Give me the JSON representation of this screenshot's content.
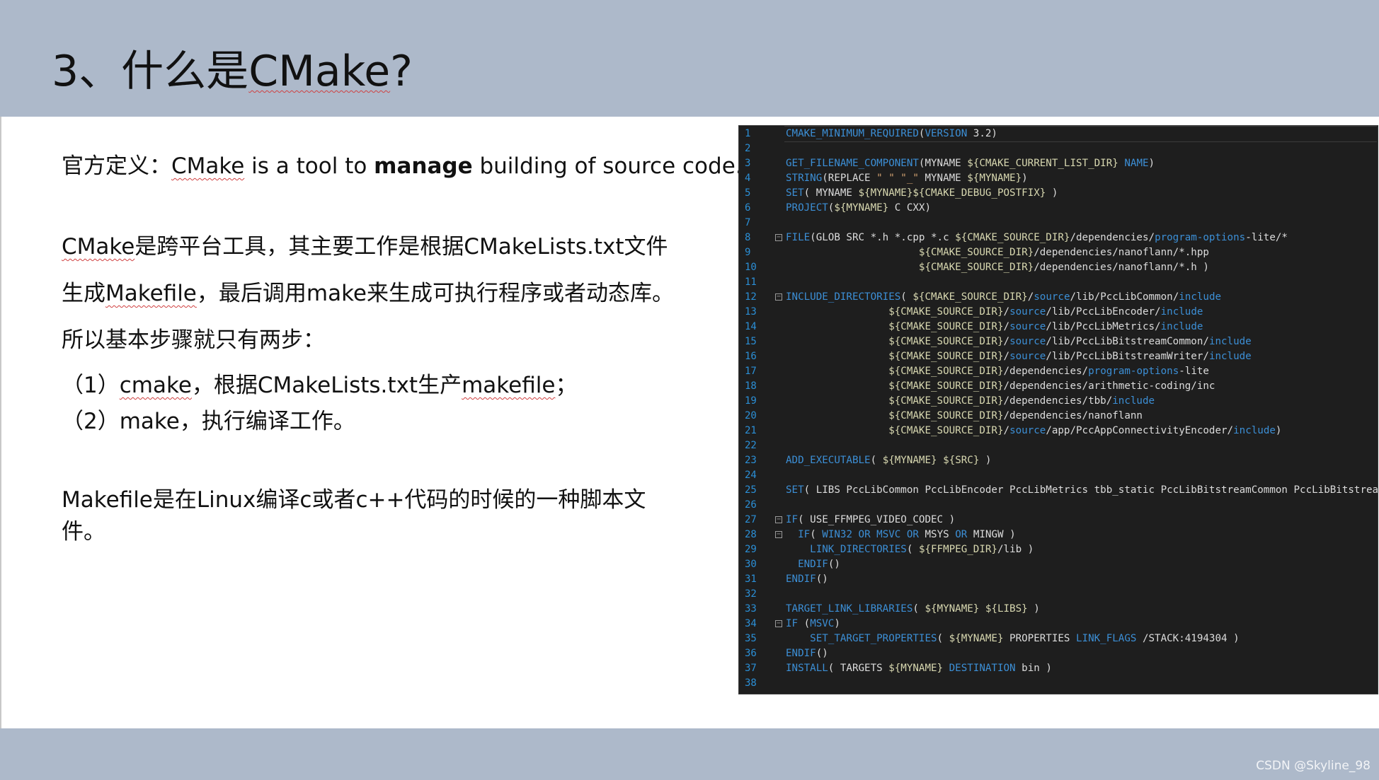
{
  "slide": {
    "title_prefix": "3、什么是",
    "title_word": "CMake",
    "title_suffix": "?",
    "definition": {
      "label": "官方定义：",
      "word": "CMake",
      "text_before_bold": " is a tool to ",
      "bold": "manage",
      "text_after_bold": " building of source code."
    },
    "para1": {
      "word1": "CMake",
      "line1_rest": "是跨平台工具，其主要工作是根据CMakeLists.txt文件",
      "line2_prefix": "生成",
      "line2_word": "Makefile",
      "line2_rest": "，最后调用make来生成可执行程序或者动态库。",
      "line3": "所以基本步骤就只有两步："
    },
    "steps": [
      {
        "prefix": "（1）",
        "word": "cmake",
        "middle": "，根据CMakeLists.txt生产",
        "word2": "makefile",
        "suffix": "；"
      },
      {
        "text": "（2）make，执行编译工作。"
      }
    ],
    "para2": {
      "line1": "Makefile是在Linux编译c或者c++代码的时候的一种脚本文",
      "line2": "件。"
    },
    "watermark": "CSDN @Skyline_98"
  },
  "code": {
    "lines": [
      {
        "n": "1",
        "parts": [
          [
            "kw",
            "CMAKE_MINIMUM_REQUIRED"
          ],
          [
            "plain",
            "("
          ],
          [
            "kw",
            "VERSION"
          ],
          [
            "plain",
            " 3.2)"
          ]
        ]
      },
      {
        "n": "2",
        "parts": []
      },
      {
        "n": "3",
        "parts": [
          [
            "kw",
            "GET_FILENAME_COMPONENT"
          ],
          [
            "plain",
            "(MYNAME "
          ],
          [
            "var",
            "${CMAKE_CURRENT_LIST_DIR}"
          ],
          [
            "plain",
            " "
          ],
          [
            "kw",
            "NAME"
          ],
          [
            "plain",
            ")"
          ]
        ]
      },
      {
        "n": "4",
        "parts": [
          [
            "kw",
            "STRING"
          ],
          [
            "plain",
            "(REPLACE "
          ],
          [
            "str",
            "\" \" \"_\""
          ],
          [
            "plain",
            " MYNAME "
          ],
          [
            "var",
            "${MYNAME}"
          ],
          [
            "plain",
            ")"
          ]
        ]
      },
      {
        "n": "5",
        "parts": [
          [
            "kw",
            "SET"
          ],
          [
            "plain",
            "( MYNAME "
          ],
          [
            "var",
            "${MYNAME}${CMAKE_DEBUG_POSTFIX}"
          ],
          [
            "plain",
            " )"
          ]
        ]
      },
      {
        "n": "6",
        "parts": [
          [
            "kw",
            "PROJECT"
          ],
          [
            "plain",
            "("
          ],
          [
            "var",
            "${MYNAME}"
          ],
          [
            "plain",
            " C CXX)"
          ]
        ]
      },
      {
        "n": "7",
        "parts": []
      },
      {
        "n": "8",
        "fold": true,
        "parts": [
          [
            "kw",
            "FILE"
          ],
          [
            "plain",
            "(GLOB SRC *.h *.cpp *.c "
          ],
          [
            "var",
            "${CMAKE_SOURCE_DIR}"
          ],
          [
            "plain",
            "/dependencies/"
          ],
          [
            "kw",
            "program-options"
          ],
          [
            "plain",
            "-lite/*"
          ]
        ]
      },
      {
        "n": "9",
        "parts": [
          [
            "plain",
            "                      "
          ],
          [
            "var",
            "${CMAKE_SOURCE_DIR}"
          ],
          [
            "plain",
            "/dependencies/nanoflann/*.hpp"
          ]
        ]
      },
      {
        "n": "10",
        "parts": [
          [
            "plain",
            "                      "
          ],
          [
            "var",
            "${CMAKE_SOURCE_DIR}"
          ],
          [
            "plain",
            "/dependencies/nanoflann/*.h )"
          ]
        ]
      },
      {
        "n": "11",
        "parts": []
      },
      {
        "n": "12",
        "fold": true,
        "parts": [
          [
            "kw",
            "INCLUDE_DIRECTORIES"
          ],
          [
            "plain",
            "( "
          ],
          [
            "var",
            "${CMAKE_SOURCE_DIR}"
          ],
          [
            "plain",
            "/"
          ],
          [
            "kw",
            "source"
          ],
          [
            "plain",
            "/lib/PccLibCommon/"
          ],
          [
            "kw",
            "include"
          ]
        ]
      },
      {
        "n": "13",
        "parts": [
          [
            "plain",
            "                 "
          ],
          [
            "var",
            "${CMAKE_SOURCE_DIR}"
          ],
          [
            "plain",
            "/"
          ],
          [
            "kw",
            "source"
          ],
          [
            "plain",
            "/lib/PccLibEncoder/"
          ],
          [
            "kw",
            "include"
          ]
        ]
      },
      {
        "n": "14",
        "parts": [
          [
            "plain",
            "                 "
          ],
          [
            "var",
            "${CMAKE_SOURCE_DIR}"
          ],
          [
            "plain",
            "/"
          ],
          [
            "kw",
            "source"
          ],
          [
            "plain",
            "/lib/PccLibMetrics/"
          ],
          [
            "kw",
            "include"
          ]
        ]
      },
      {
        "n": "15",
        "parts": [
          [
            "plain",
            "                 "
          ],
          [
            "var",
            "${CMAKE_SOURCE_DIR}"
          ],
          [
            "plain",
            "/"
          ],
          [
            "kw",
            "source"
          ],
          [
            "plain",
            "/lib/PccLibBitstreamCommon/"
          ],
          [
            "kw",
            "include"
          ]
        ]
      },
      {
        "n": "16",
        "parts": [
          [
            "plain",
            "                 "
          ],
          [
            "var",
            "${CMAKE_SOURCE_DIR}"
          ],
          [
            "plain",
            "/"
          ],
          [
            "kw",
            "source"
          ],
          [
            "plain",
            "/lib/PccLibBitstreamWriter/"
          ],
          [
            "kw",
            "include"
          ]
        ]
      },
      {
        "n": "17",
        "parts": [
          [
            "plain",
            "                 "
          ],
          [
            "var",
            "${CMAKE_SOURCE_DIR}"
          ],
          [
            "plain",
            "/dependencies/"
          ],
          [
            "kw",
            "program-options"
          ],
          [
            "plain",
            "-lite"
          ]
        ]
      },
      {
        "n": "18",
        "parts": [
          [
            "plain",
            "                 "
          ],
          [
            "var",
            "${CMAKE_SOURCE_DIR}"
          ],
          [
            "plain",
            "/dependencies/arithmetic-coding/inc"
          ]
        ]
      },
      {
        "n": "19",
        "parts": [
          [
            "plain",
            "                 "
          ],
          [
            "var",
            "${CMAKE_SOURCE_DIR}"
          ],
          [
            "plain",
            "/dependencies/tbb/"
          ],
          [
            "kw",
            "include"
          ]
        ]
      },
      {
        "n": "20",
        "parts": [
          [
            "plain",
            "                 "
          ],
          [
            "var",
            "${CMAKE_SOURCE_DIR}"
          ],
          [
            "plain",
            "/dependencies/nanoflann"
          ]
        ]
      },
      {
        "n": "21",
        "parts": [
          [
            "plain",
            "                 "
          ],
          [
            "var",
            "${CMAKE_SOURCE_DIR}"
          ],
          [
            "plain",
            "/"
          ],
          [
            "kw",
            "source"
          ],
          [
            "plain",
            "/app/PccAppConnectivityEncoder/"
          ],
          [
            "kw",
            "include"
          ],
          [
            "plain",
            ")"
          ]
        ]
      },
      {
        "n": "22",
        "parts": []
      },
      {
        "n": "23",
        "parts": [
          [
            "kw",
            "ADD_EXECUTABLE"
          ],
          [
            "plain",
            "( "
          ],
          [
            "var",
            "${MYNAME}"
          ],
          [
            "plain",
            " "
          ],
          [
            "var",
            "${SRC}"
          ],
          [
            "plain",
            " )"
          ]
        ]
      },
      {
        "n": "24",
        "parts": []
      },
      {
        "n": "25",
        "parts": [
          [
            "kw",
            "SET"
          ],
          [
            "plain",
            "( LIBS PccLibCommon PccLibEncoder PccLibMetrics tbb_static PccLibBitstreamCommon PccLibBitstreamWriter )"
          ]
        ]
      },
      {
        "n": "26",
        "parts": []
      },
      {
        "n": "27",
        "fold": true,
        "parts": [
          [
            "kw",
            "IF"
          ],
          [
            "plain",
            "( USE_FFMPEG_VIDEO_CODEC )"
          ]
        ]
      },
      {
        "n": "28",
        "fold": true,
        "parts": [
          [
            "plain",
            "  "
          ],
          [
            "kw",
            "IF"
          ],
          [
            "plain",
            "( "
          ],
          [
            "kw",
            "WIN32 OR MSVC OR"
          ],
          [
            "plain",
            " MSYS "
          ],
          [
            "kw",
            "OR"
          ],
          [
            "plain",
            " MINGW )"
          ]
        ]
      },
      {
        "n": "29",
        "parts": [
          [
            "plain",
            "    "
          ],
          [
            "kw",
            "LINK_DIRECTORIES"
          ],
          [
            "plain",
            "( "
          ],
          [
            "var",
            "${FFMPEG_DIR}"
          ],
          [
            "plain",
            "/lib )"
          ]
        ]
      },
      {
        "n": "30",
        "parts": [
          [
            "plain",
            "  "
          ],
          [
            "kw",
            "ENDIF"
          ],
          [
            "plain",
            "()"
          ]
        ]
      },
      {
        "n": "31",
        "parts": [
          [
            "kw",
            "ENDIF"
          ],
          [
            "plain",
            "()"
          ]
        ]
      },
      {
        "n": "32",
        "parts": []
      },
      {
        "n": "33",
        "parts": [
          [
            "kw",
            "TARGET_LINK_LIBRARIES"
          ],
          [
            "plain",
            "( "
          ],
          [
            "var",
            "${MYNAME}"
          ],
          [
            "plain",
            " "
          ],
          [
            "var",
            "${LIBS}"
          ],
          [
            "plain",
            " )"
          ]
        ]
      },
      {
        "n": "34",
        "fold": true,
        "parts": [
          [
            "kw",
            "IF"
          ],
          [
            "plain",
            " ("
          ],
          [
            "kw",
            "MSVC"
          ],
          [
            "plain",
            ")"
          ]
        ]
      },
      {
        "n": "35",
        "parts": [
          [
            "plain",
            "    "
          ],
          [
            "kw",
            "SET_TARGET_PROPERTIES"
          ],
          [
            "plain",
            "( "
          ],
          [
            "var",
            "${MYNAME}"
          ],
          [
            "plain",
            " PROPERTIES "
          ],
          [
            "kw",
            "LINK_FLAGS"
          ],
          [
            "plain",
            " /STACK:4194304 )"
          ]
        ]
      },
      {
        "n": "36",
        "parts": [
          [
            "kw",
            "ENDIF"
          ],
          [
            "plain",
            "()"
          ]
        ]
      },
      {
        "n": "37",
        "parts": [
          [
            "kw",
            "INSTALL"
          ],
          [
            "plain",
            "( TARGETS "
          ],
          [
            "var",
            "${MYNAME}"
          ],
          [
            "plain",
            " "
          ],
          [
            "kw",
            "DESTINATION"
          ],
          [
            "plain",
            " bin )"
          ]
        ]
      },
      {
        "n": "38",
        "parts": []
      }
    ]
  }
}
